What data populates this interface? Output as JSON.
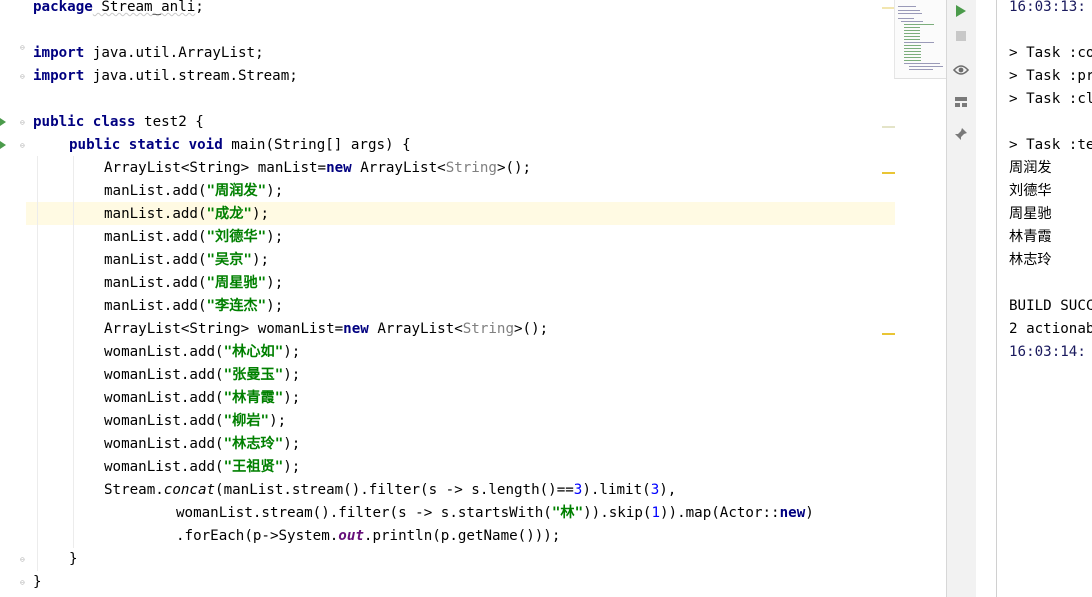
{
  "editor": {
    "lines": {
      "pkg_kw": "package",
      "pkg_name": " Stream_anli",
      "pkg_end": ";",
      "imp_kw": "import",
      "imp1": " java.util.ArrayList;",
      "imp2": " java.util.stream.Stream;",
      "class_kw": "public class",
      "class_name": " test2 {",
      "main_kw": "public static void",
      "main_sig": " main(String[] args) {",
      "man_decl_a": "ArrayList<String> manList=",
      "new_kw": "new",
      "man_decl_b": " ArrayList<",
      "string_gen": "String",
      "decl_end": ">();",
      "man_add_prefix": "manList.add(",
      "woman_add_prefix": "womanList.add(",
      "add_suffix": ");",
      "man_names": [
        "\"周润发\"",
        "\"成龙\"",
        "\"刘德华\"",
        "\"吴京\"",
        "\"周星驰\"",
        "\"李连杰\""
      ],
      "woman_decl_a": "ArrayList<String> womanList=",
      "woman_names": [
        "\"林心如\"",
        "\"张曼玉\"",
        "\"林青霞\"",
        "\"柳岩\"",
        "\"林志玲\"",
        "\"王祖贤\""
      ],
      "concat_a": "Stream.",
      "concat_m": "concat",
      "concat_b": "(manList.stream().filter(s -> s.length()==",
      "num3": "3",
      "concat_c": ").limit(",
      "concat_d": "),",
      "woman_stream_a": "womanList.stream().filter(s -> s.startsWith(",
      "lin": "\"林\"",
      "woman_stream_b": ")).skip(",
      "num1": "1",
      "woman_stream_c": ")).map(Actor::",
      "woman_stream_d": ")",
      "foreach_a": ".forEach(p->System.",
      "out": "out",
      "foreach_b": ".println(p.getName()));",
      "close_method": "}",
      "close_class": "}"
    }
  },
  "toolbar": {
    "run_icon": "play-icon",
    "stop_icon": "stop-icon",
    "view_icon": "eye-icon",
    "layout_icon": "layout-icon",
    "pin_icon": "pin-icon"
  },
  "console": {
    "lines": [
      "16:03:13:",
      "",
      "> Task :co",
      "> Task :pr",
      "> Task :cl",
      "",
      "> Task :te",
      "周润发",
      "刘德华",
      "周星驰",
      "林青霞",
      "林志玲",
      "",
      "BUILD SUCC",
      "2 actionab",
      "16:03:14:"
    ]
  },
  "colors": {
    "keyword": "#000080",
    "string": "#008000",
    "number": "#0000ff",
    "caret_line": "#fffae3",
    "run_green": "#4b9b4b"
  }
}
